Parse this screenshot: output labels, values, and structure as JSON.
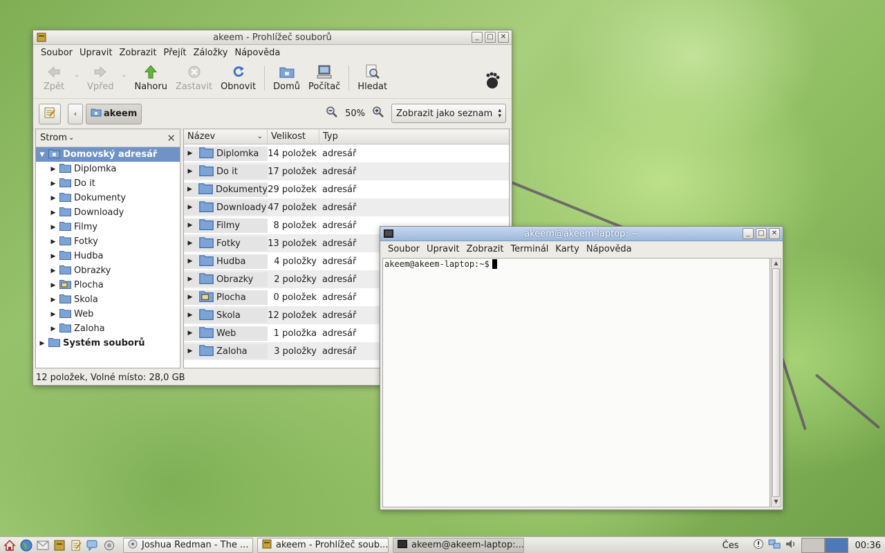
{
  "file_manager": {
    "title": "akeem - Prohlížeč souborů",
    "menu": [
      "Soubor",
      "Upravit",
      "Zobrazit",
      "Přejít",
      "Záložky",
      "Nápověda"
    ],
    "toolbar": {
      "back": "Zpět",
      "forward": "Vpřed",
      "up": "Nahoru",
      "stop": "Zastavit",
      "reload": "Obnovit",
      "home": "Domů",
      "computer": "Počítač",
      "search": "Hledat"
    },
    "location": {
      "path_button": "akeem",
      "zoom": "50%",
      "view_mode": "Zobrazit jako seznam"
    },
    "sidebar": {
      "mode": "Strom",
      "root": "Domovský adresář",
      "items": [
        "Diplomka",
        "Do it",
        "Dokumenty",
        "Downloady",
        "Filmy",
        "Fotky",
        "Hudba",
        "Obrazky",
        "Plocha",
        "Skola",
        "Web",
        "Zaloha"
      ],
      "filesystem": "Systém souborů"
    },
    "columns": {
      "name": "Název",
      "size": "Velikost",
      "type": "Typ"
    },
    "rows": [
      {
        "name": "Diplomka",
        "size": "14 položek",
        "type": "adresář"
      },
      {
        "name": "Do it",
        "size": "17 položek",
        "type": "adresář"
      },
      {
        "name": "Dokumenty",
        "size": "29 položek",
        "type": "adresář"
      },
      {
        "name": "Downloady",
        "size": "47 položek",
        "type": "adresář"
      },
      {
        "name": "Filmy",
        "size": "8 položek",
        "type": "adresář"
      },
      {
        "name": "Fotky",
        "size": "13 položek",
        "type": "adresář"
      },
      {
        "name": "Hudba",
        "size": "4 položky",
        "type": "adresář"
      },
      {
        "name": "Obrazky",
        "size": "2 položky",
        "type": "adresář"
      },
      {
        "name": "Plocha",
        "size": "0 položek",
        "type": "adresář"
      },
      {
        "name": "Skola",
        "size": "12 položek",
        "type": "adresář"
      },
      {
        "name": "Web",
        "size": "1 položka",
        "type": "adresář"
      },
      {
        "name": "Zaloha",
        "size": "3 položky",
        "type": "adresář"
      }
    ],
    "status": "12 položek, Volné místo: 28,0 GB"
  },
  "terminal": {
    "title": "akeem@akeem-laptop: ~",
    "menu": [
      "Soubor",
      "Upravit",
      "Zobrazit",
      "Terminál",
      "Karty",
      "Nápověda"
    ],
    "prompt": "akeem@akeem-laptop:~$"
  },
  "panel": {
    "tasks": [
      "Joshua Redman - The ...",
      "akeem - Prohlížeč soub...",
      "akeem@akeem-laptop:..."
    ],
    "keyboard_layout": "Čes",
    "clock": "00:36"
  },
  "colors": {
    "selection": "#6f93c7",
    "folder": "#7ea4d6",
    "titlebar_active": "#9db8dd"
  }
}
